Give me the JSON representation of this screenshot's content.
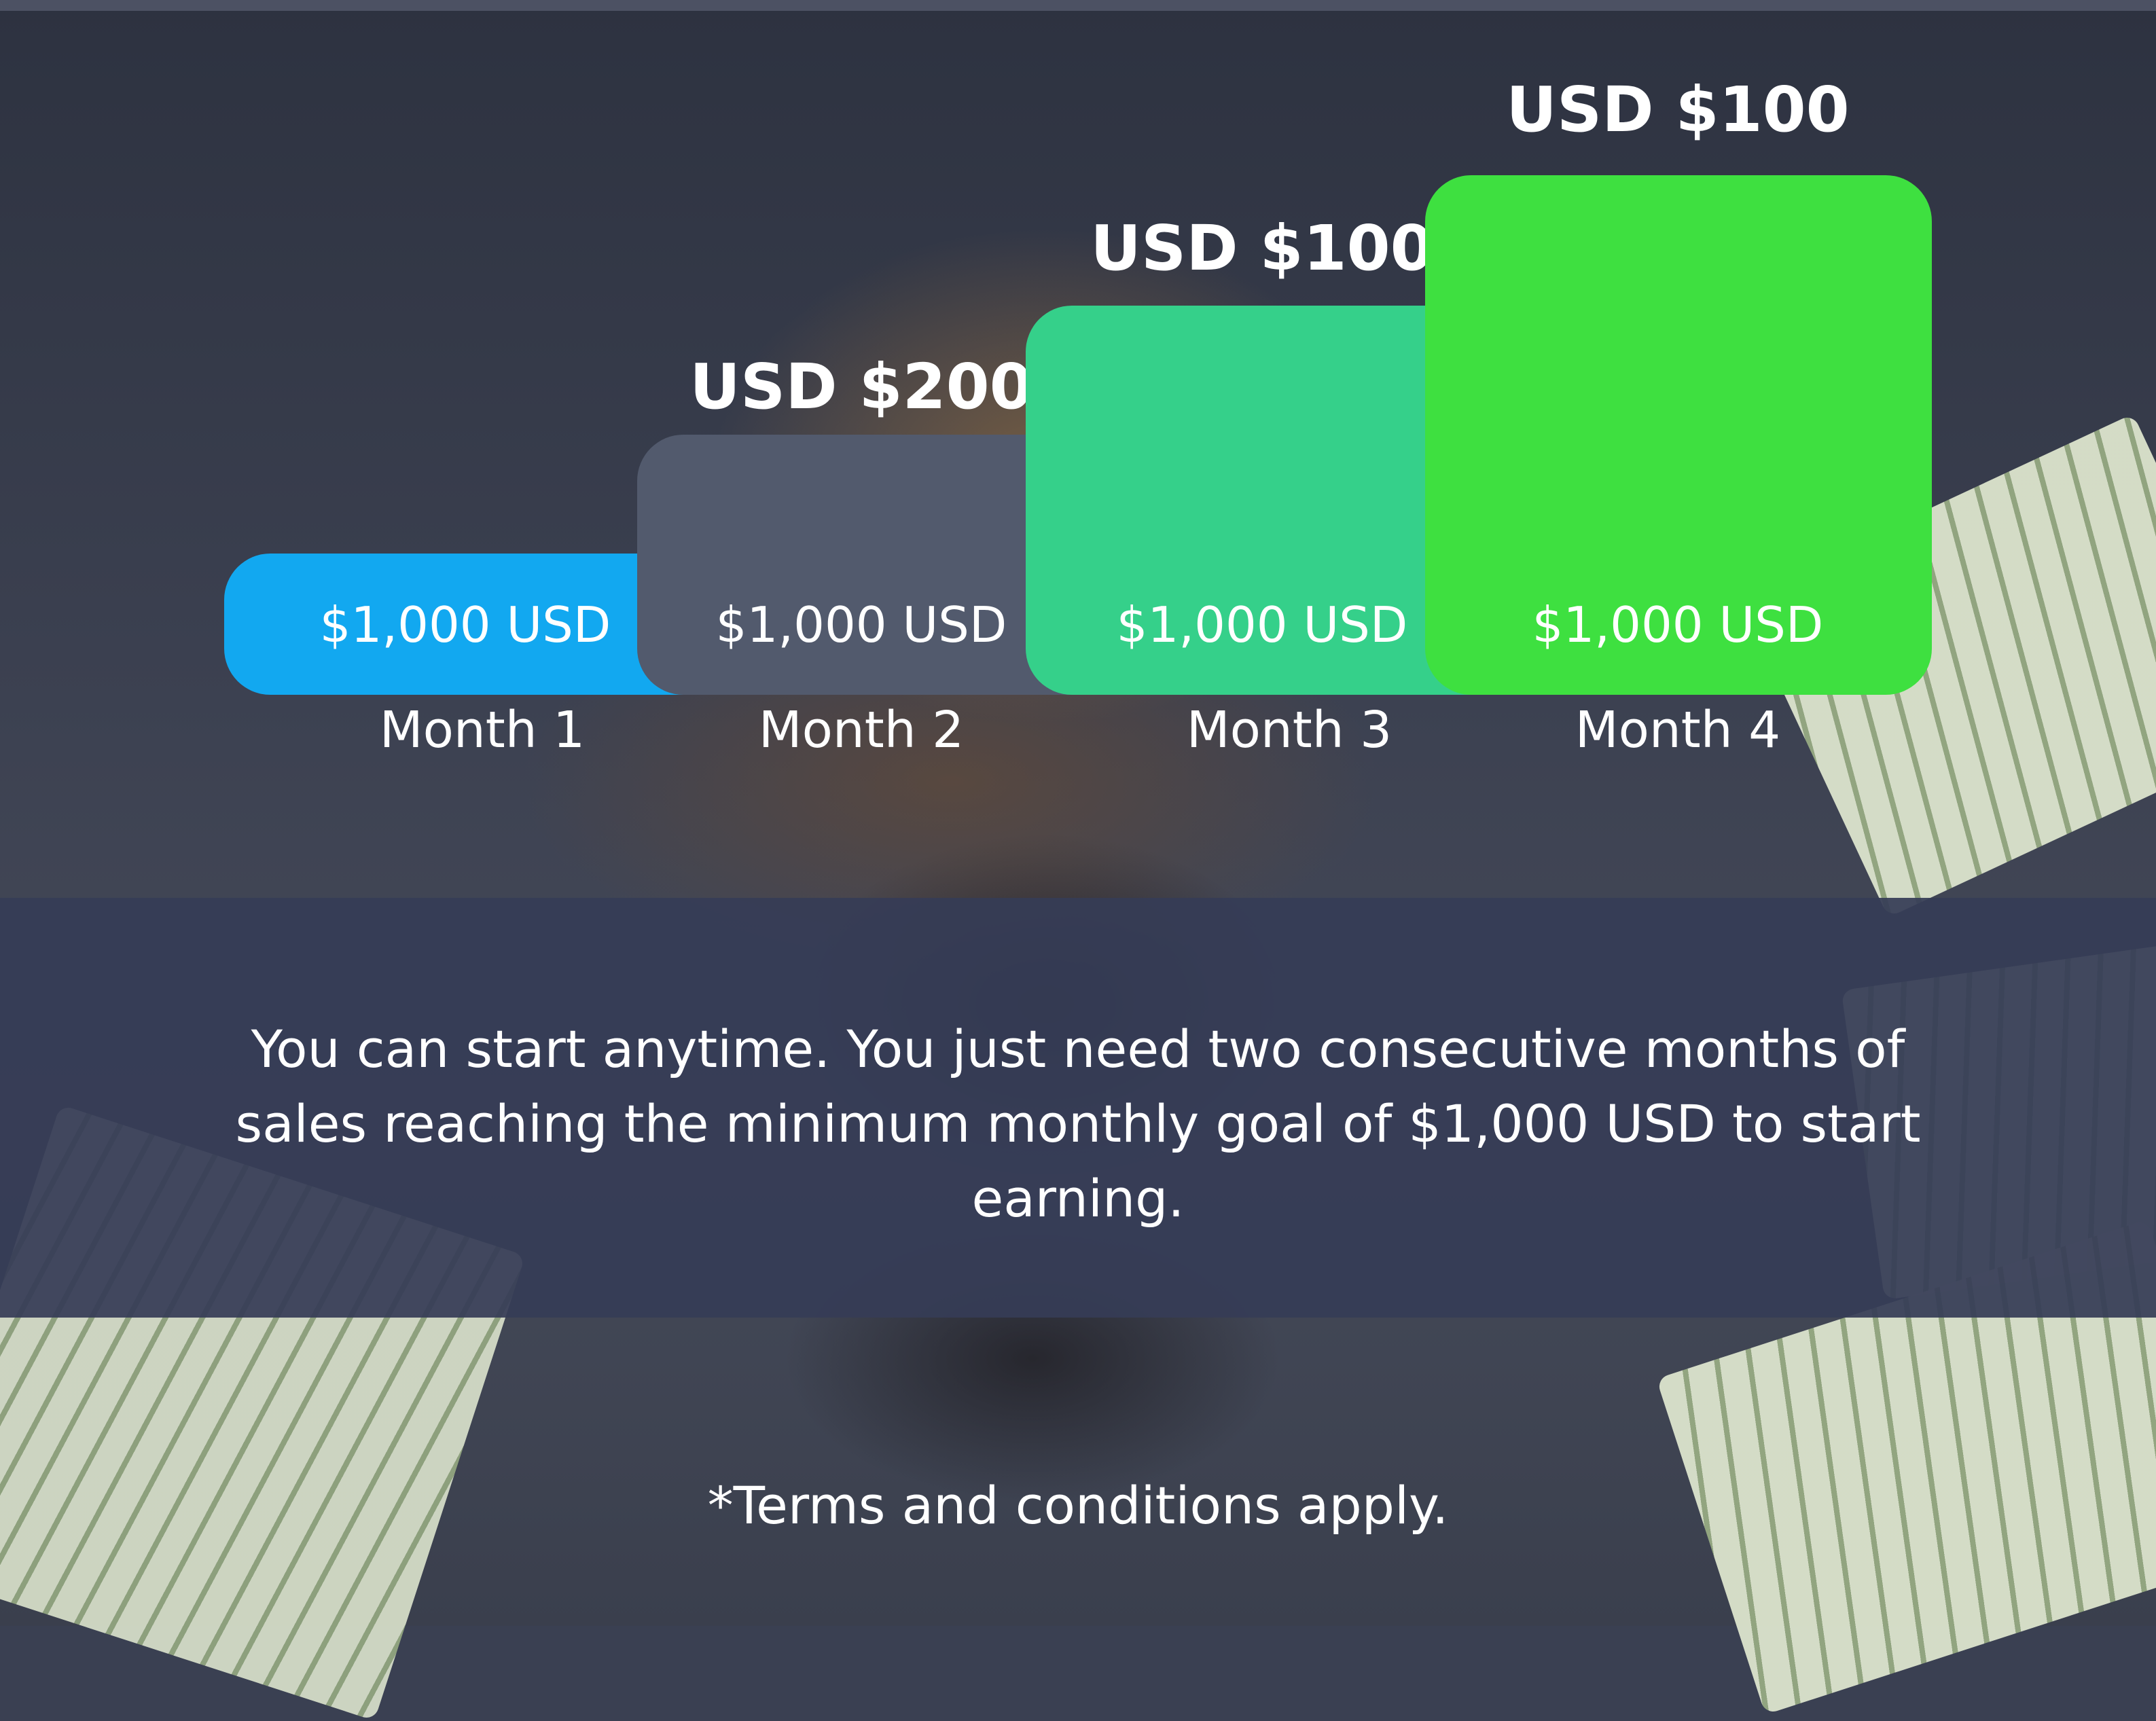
{
  "chart_data": {
    "type": "bar",
    "categories": [
      "Month 1",
      "Month 2",
      "Month 3",
      "Month 4"
    ],
    "values": [
      1000,
      1000,
      1000,
      1000
    ],
    "bar_labels": [
      "$1,000 USD",
      "$1,000 USD",
      "$1,000 USD",
      "$1,000 USD"
    ],
    "bonus_labels": [
      "",
      "USD $200",
      "USD $100",
      "USD $100"
    ],
    "colors": [
      "#12a8f0",
      "#525a6d",
      "#35d08a",
      "#3ee040"
    ]
  },
  "info": {
    "text": "You can start anytime. You just need two consecutive months of sales reaching the minimum monthly goal of $1,000 USD to start earning."
  },
  "terms": {
    "text": "*Terms and conditions apply."
  }
}
